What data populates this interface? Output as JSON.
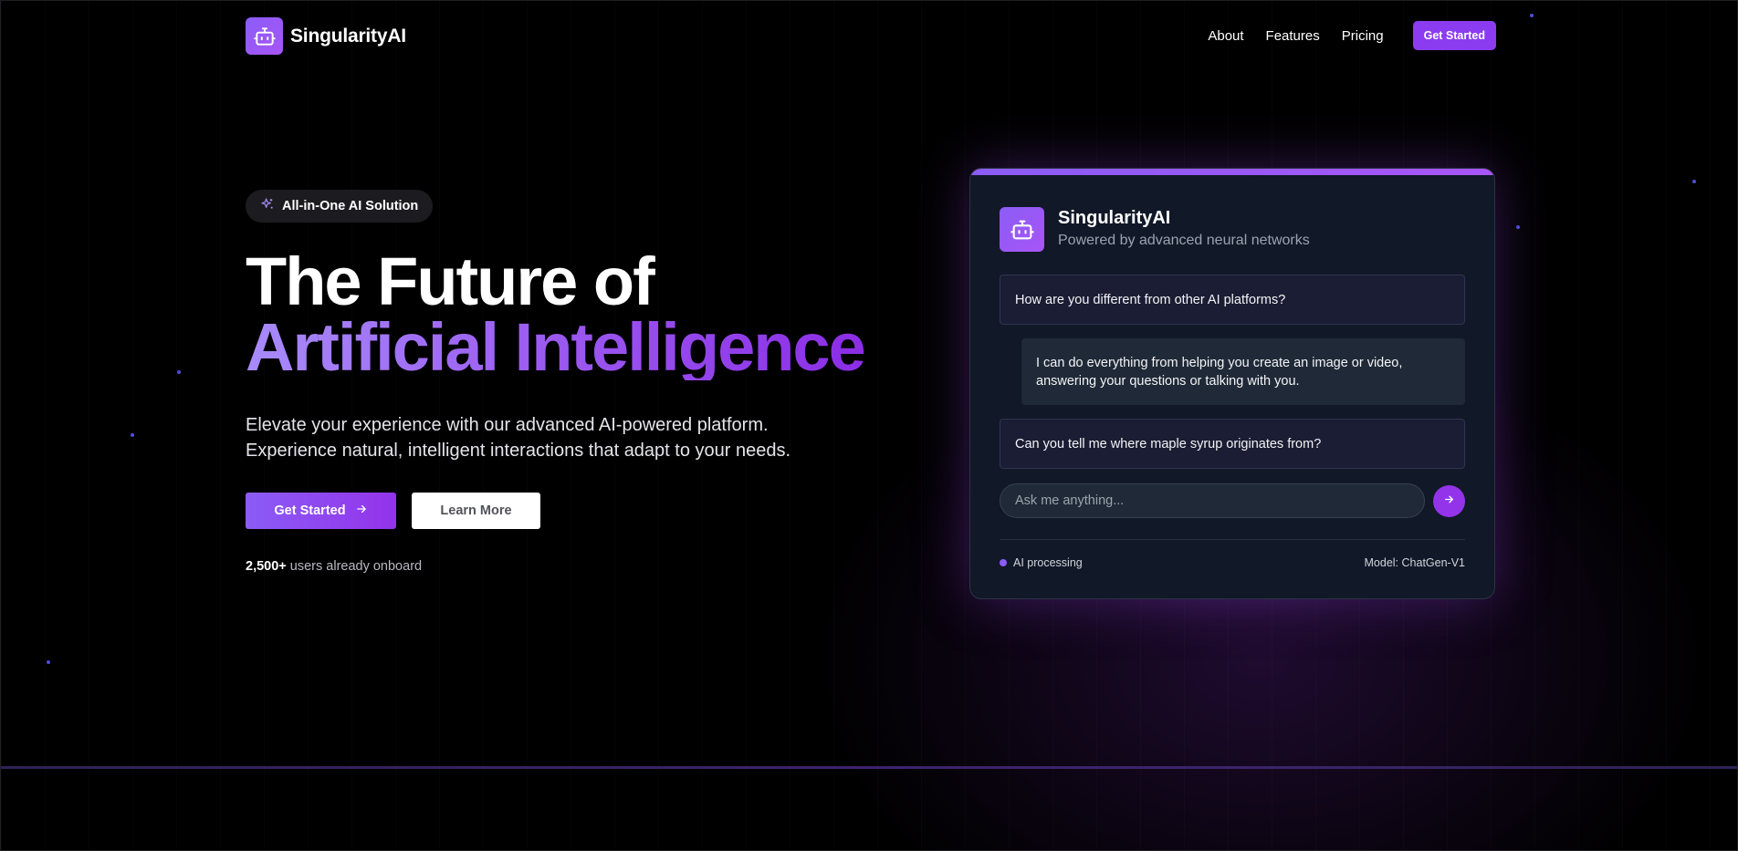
{
  "brand": {
    "name": "SingularityAI",
    "logo_icon": "robot-icon"
  },
  "nav": {
    "links": [
      "About",
      "Features",
      "Pricing"
    ],
    "cta_label": "Get Started"
  },
  "hero": {
    "badge_icon": "sparkles-icon",
    "badge_label": "All-in-One AI Solution",
    "title_line1": "The Future of",
    "title_line2": "Artificial Intelligence",
    "subtitle_line1": "Elevate your experience with our advanced AI-powered platform.",
    "subtitle_line2": "Experience natural, intelligent interactions that adapt to your needs.",
    "primary_cta": "Get Started",
    "secondary_cta": "Learn More",
    "users_count": "2,500+",
    "users_text": "users already onboard"
  },
  "chat": {
    "title": "SingularityAI",
    "subtitle": "Powered by advanced neural networks",
    "messages": [
      {
        "role": "user",
        "text": "How are you different from other AI platforms?"
      },
      {
        "role": "ai",
        "text": "I can do everything from helping you create an image or video, answering your questions or talking with you."
      },
      {
        "role": "user",
        "text": "Can you tell me where maple syrup originates from?"
      }
    ],
    "input_placeholder": "Ask me anything...",
    "status": "AI processing",
    "model": "Model: ChatGen-V1"
  },
  "colors": {
    "accent": "#8b5cf6",
    "accent_dark": "#9333ea",
    "background": "#000000",
    "card": "#111827"
  }
}
